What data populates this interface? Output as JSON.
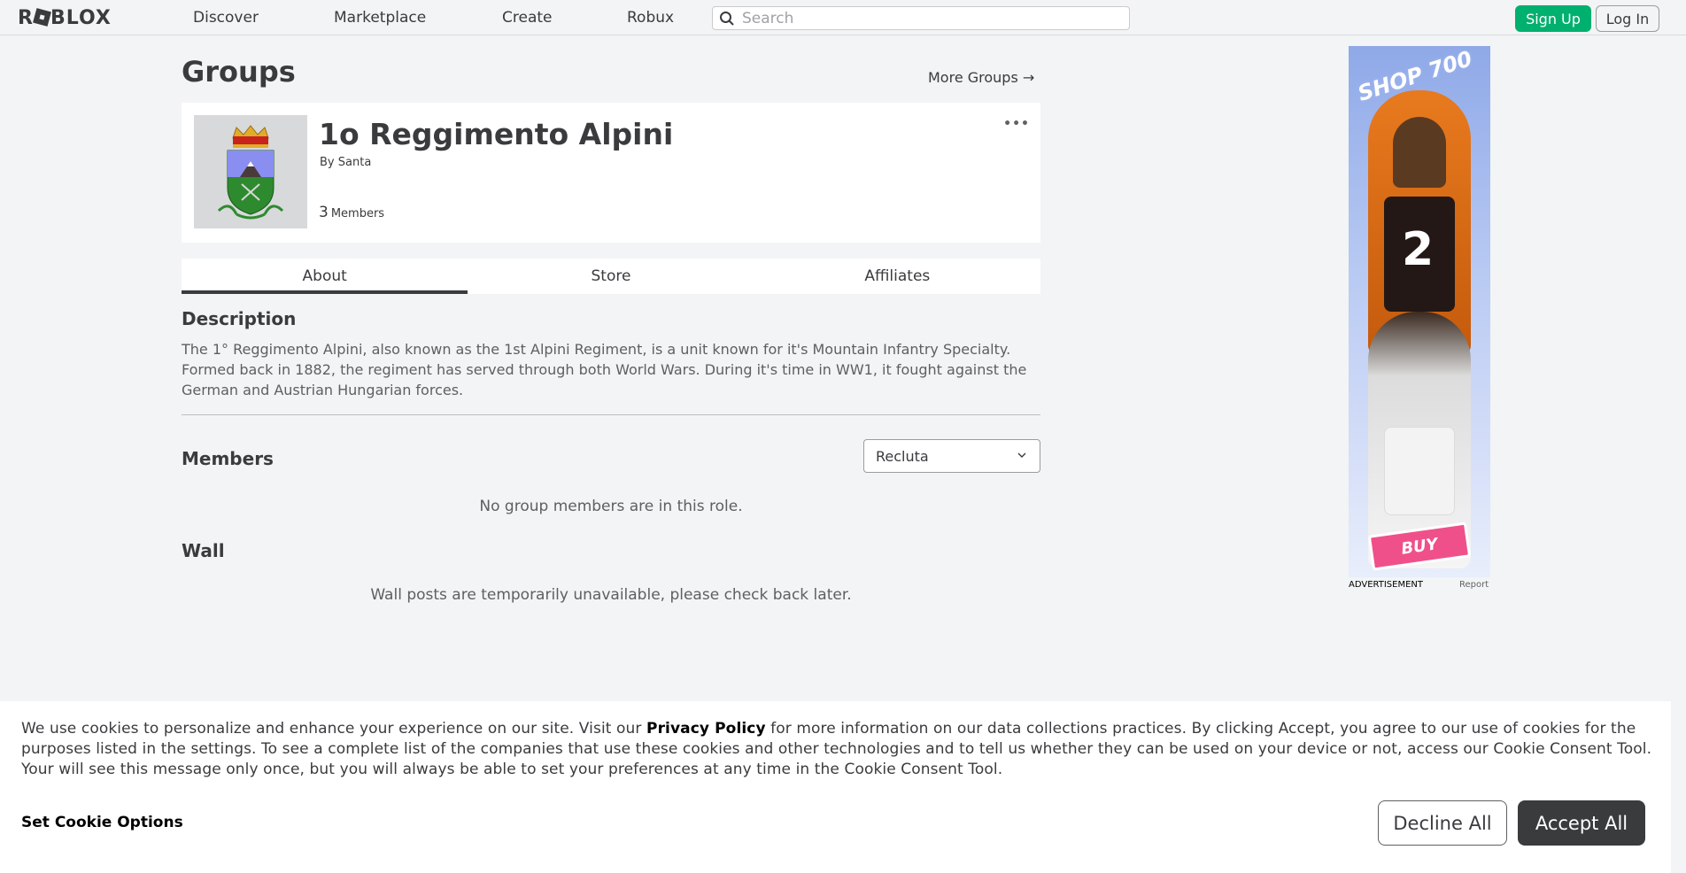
{
  "nav": {
    "logo": "ROBLOX",
    "items": [
      "Discover",
      "Marketplace",
      "Create",
      "Robux"
    ],
    "search_placeholder": "Search",
    "signup": "Sign Up",
    "login": "Log In"
  },
  "page": {
    "title": "Groups",
    "more_groups": "More Groups →"
  },
  "group": {
    "name": "1o Reggimento Alpini",
    "by_prefix": "By",
    "owner": "Santa",
    "members_count": "3",
    "members_label": "Members",
    "menu": "•••"
  },
  "tabs": [
    "About",
    "Store",
    "Affiliates"
  ],
  "about": {
    "description_heading": "Description",
    "description": "The 1° Reggimento Alpini, also known as the 1st Alpini Regiment, is a unit known for it's Mountain Infantry Specialty. Formed back in 1882, the regiment has served through both World Wars. During it's time in WW1, it fought against the German and Austrian Hungarian forces.",
    "members_heading": "Members",
    "role_selected": "Recluta",
    "no_members": "No group members are in this role.",
    "wall_heading": "Wall",
    "wall_message": "Wall posts are temporarily unavailable, please check back later."
  },
  "ad": {
    "headline": "SHOP 700",
    "button": "BUY",
    "label": "ADVERTISEMENT",
    "report": "Report"
  },
  "cookie": {
    "text_before": "We use cookies to personalize and enhance your experience on our site. Visit our ",
    "privacy_link": "Privacy Policy",
    "text_after": " for more information on our data collections practices. By clicking Accept, you agree to our use of cookies for the purposes listed in the settings. To see a complete list of the companies that use these cookies and other technologies and to tell us whether they can be used on your device or not, access our Cookie Consent Tool. Your will see this message only once, but you will always be able to set your preferences at any time in the Cookie Consent Tool.",
    "set_options": "Set Cookie Options",
    "decline": "Decline All",
    "accept": "Accept All"
  }
}
